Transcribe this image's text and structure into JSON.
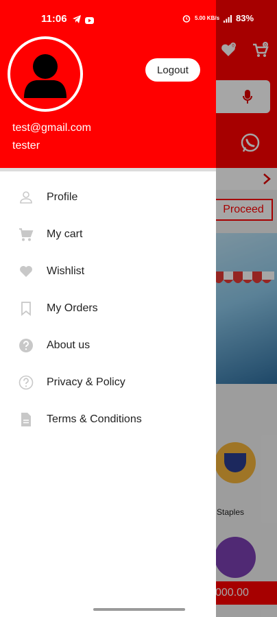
{
  "status_bar": {
    "time": "11:06",
    "right_data": "5.00 KB/s",
    "battery": "83%"
  },
  "background_app": {
    "proceed_label": "Proceed",
    "category_label": "Staples",
    "bottom_total": "000.00",
    "icons": [
      "wishlist-icon",
      "cart-icon",
      "mic-icon",
      "whatsapp-icon",
      "chevron-right-icon"
    ]
  },
  "drawer": {
    "logout_label": "Logout",
    "user": {
      "email": "test@gmail.com",
      "name": "tester"
    },
    "menu": [
      {
        "label": "Profile",
        "icon": "person-icon"
      },
      {
        "label": "My cart",
        "icon": "cart-icon"
      },
      {
        "label": "Wishlist",
        "icon": "heart-icon"
      },
      {
        "label": "My Orders",
        "icon": "bookmark-icon"
      },
      {
        "label": "About us",
        "icon": "help-circle-icon"
      },
      {
        "label": "Privacy & Policy",
        "icon": "help-outline-icon"
      },
      {
        "label": "Terms & Conditions",
        "icon": "document-icon"
      }
    ]
  },
  "colors": {
    "brand": "#ff0000",
    "icon_gray": "#c8c8c8",
    "text": "#222222"
  }
}
